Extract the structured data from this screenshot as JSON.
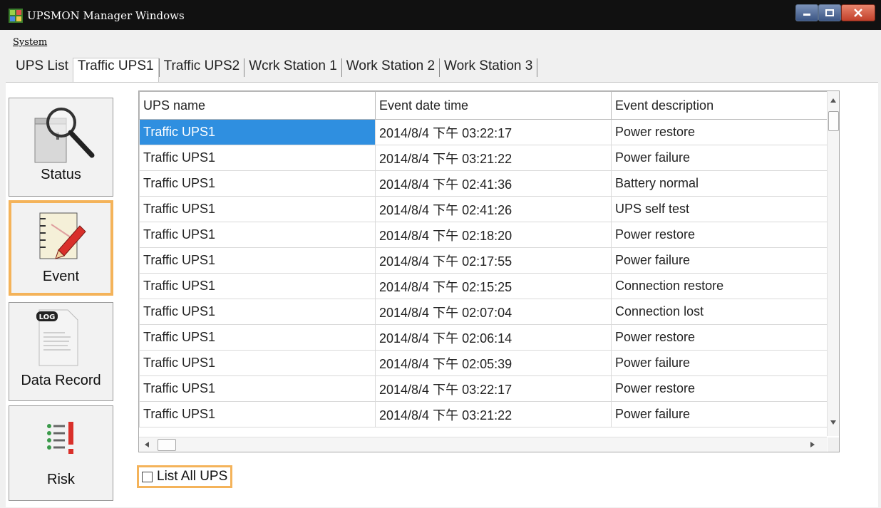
{
  "window": {
    "title": "UPSMON Manager Windows"
  },
  "menu": {
    "system": "System"
  },
  "tabs": [
    "UPS List",
    "Traffic UPS1",
    "Traffic UPS2",
    "Wcrk Station 1",
    "Work Station 2",
    "Work Station 3"
  ],
  "active_tab": "Traffic UPS1",
  "sidebar": {
    "status": "Status",
    "event": "Event",
    "data_record": "Data Record",
    "risk": "Risk",
    "log_badge": "LOG"
  },
  "table": {
    "columns": [
      "UPS name",
      "Event date time",
      "Event description"
    ],
    "rows": [
      [
        "Traffic UPS1",
        "2014/8/4 下午 03:22:17",
        "Power restore"
      ],
      [
        "Traffic UPS1",
        "2014/8/4 下午 03:21:22",
        "Power failure"
      ],
      [
        "Traffic UPS1",
        "2014/8/4 下午 02:41:36",
        "Battery normal"
      ],
      [
        "Traffic UPS1",
        "2014/8/4 下午 02:41:26",
        "UPS self test"
      ],
      [
        "Traffic UPS1",
        "2014/8/4 下午 02:18:20",
        "Power restore"
      ],
      [
        "Traffic UPS1",
        "2014/8/4 下午 02:17:55",
        "Power failure"
      ],
      [
        "Traffic UPS1",
        "2014/8/4 下午 02:15:25",
        "Connection restore"
      ],
      [
        "Traffic UPS1",
        "2014/8/4 下午 02:07:04",
        "Connection lost"
      ],
      [
        "Traffic UPS1",
        "2014/8/4 下午 02:06:14",
        "Power restore"
      ],
      [
        "Traffic UPS1",
        "2014/8/4 下午 02:05:39",
        "Power failure"
      ],
      [
        "Traffic UPS1",
        "2014/8/4 下午 03:22:17",
        "Power restore"
      ],
      [
        "Traffic UPS1",
        "2014/8/4 下午 03:21:22",
        "Power failure"
      ]
    ]
  },
  "list_all": {
    "label": "List All UPS",
    "checked": false
  },
  "colors": {
    "selection": "#2f8fe0",
    "highlight": "#f4b35a",
    "titlebar": "#111111"
  }
}
